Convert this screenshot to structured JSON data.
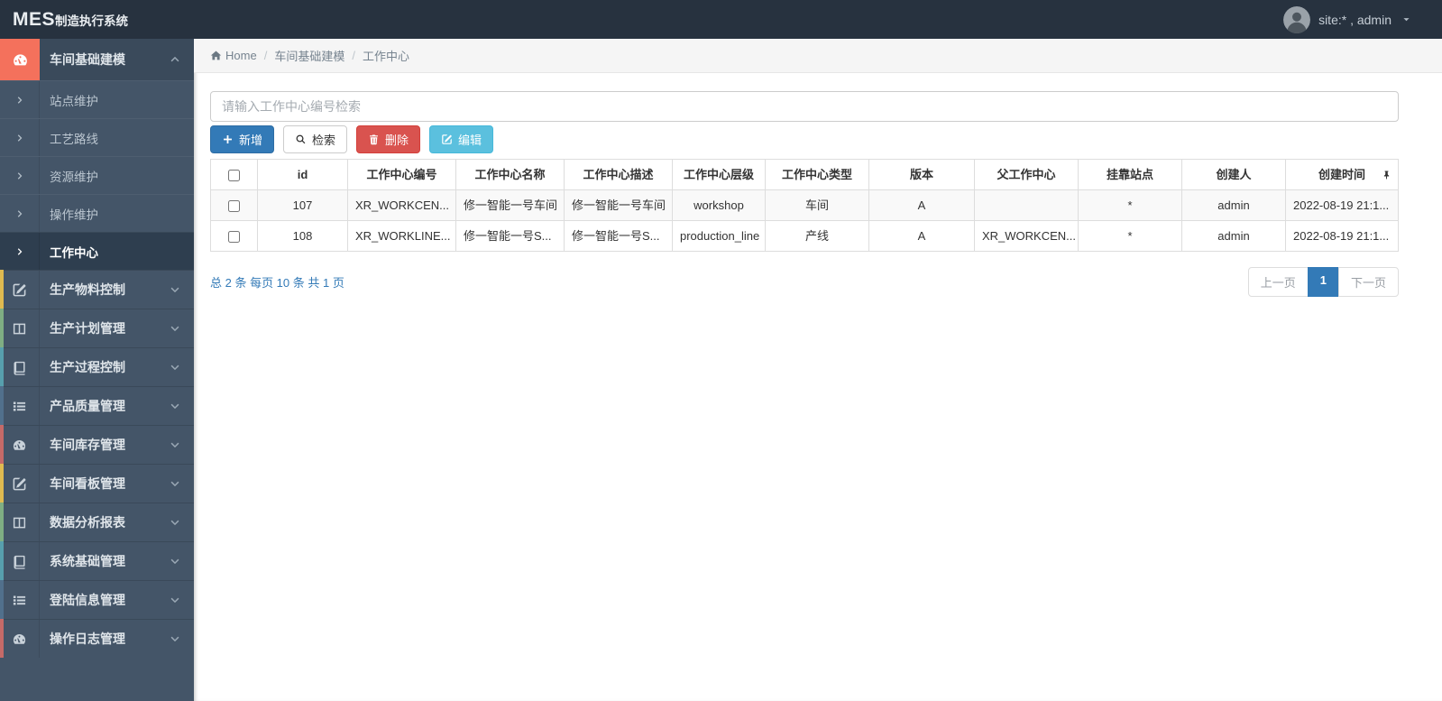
{
  "colors": {
    "navbar_bg": "#27323F",
    "sidebar_bg": "#445568",
    "sidebar_open_icon_bg": "#F4715C",
    "primary": "#337AB7",
    "danger": "#D9534F",
    "info": "#5BC0DE",
    "link_blue": "#337AB7"
  },
  "navbar": {
    "brand_mes": "MES",
    "brand_rest": "制造执行系统",
    "user_label": "site:* , admin"
  },
  "sidebar": {
    "active_parent": {
      "label": "车间基础建模",
      "icon": "gauge-icon",
      "accent": "#F4715C"
    },
    "submenu": {
      "active_index": 4,
      "items": [
        "站点维护",
        "工艺路线",
        "资源维护",
        "操作维护",
        "工作中心"
      ]
    },
    "items": [
      {
        "label": "生产物料控制",
        "icon": "pencil-square-icon",
        "accent": "#DFBA50"
      },
      {
        "label": "生产计划管理",
        "icon": "columns-icon",
        "accent": "#7FAE83"
      },
      {
        "label": "生产过程控制",
        "icon": "book-icon",
        "accent": "#579FAD"
      },
      {
        "label": "产品质量管理",
        "icon": "list-icon",
        "accent": "#51708C"
      },
      {
        "label": "车间库存管理",
        "icon": "gauge-icon",
        "accent": "#C56A68"
      },
      {
        "label": "车间看板管理",
        "icon": "pencil-square-icon",
        "accent": "#DFBA50"
      },
      {
        "label": "数据分析报表",
        "icon": "columns-icon",
        "accent": "#7FAE83"
      },
      {
        "label": "系统基础管理",
        "icon": "book-icon",
        "accent": "#579FAD"
      },
      {
        "label": "登陆信息管理",
        "icon": "list-icon",
        "accent": "#51708C"
      },
      {
        "label": "操作日志管理",
        "icon": "gauge-icon",
        "accent": "#C56A68"
      }
    ]
  },
  "breadcrumb": {
    "home_label": "Home",
    "separator": "/",
    "items": [
      "车间基础建模",
      "工作中心"
    ]
  },
  "toolbar": {
    "search_placeholder": "请输入工作中心编号检索",
    "search_value": "",
    "buttons": [
      {
        "name": "add-button",
        "label": "新增",
        "icon": "plus-icon",
        "style": "primary"
      },
      {
        "name": "search-button",
        "label": "检索",
        "icon": "search-icon",
        "style": "default"
      },
      {
        "name": "delete-button",
        "label": "删除",
        "icon": "trash-icon",
        "style": "danger"
      },
      {
        "name": "edit-button",
        "label": "编辑",
        "icon": "edit-icon",
        "style": "info"
      }
    ]
  },
  "table": {
    "headers": [
      {
        "checkbox": true
      },
      {
        "label": "id"
      },
      {
        "label": "工作中心编号"
      },
      {
        "label": "工作中心名称"
      },
      {
        "label": "工作中心描述"
      },
      {
        "label": "工作中心层级"
      },
      {
        "label": "工作中心类型"
      },
      {
        "label": "版本"
      },
      {
        "label": "父工作中心"
      },
      {
        "label": "挂靠站点"
      },
      {
        "label": "创建人"
      },
      {
        "label": "创建时间",
        "pin": true
      }
    ],
    "rows": [
      {
        "cells": [
          "107",
          "XR_WORKCEN...",
          "修一智能一号车间",
          "修一智能一号车间",
          "workshop",
          "车间",
          "A",
          "",
          "*",
          "admin",
          "2022-08-19 21:1..."
        ]
      },
      {
        "cells": [
          "108",
          "XR_WORKLINE...",
          "修一智能一号S...",
          "修一智能一号S...",
          "production_line",
          "产线",
          "A",
          "XR_WORKCEN...",
          "*",
          "admin",
          "2022-08-19 21:1..."
        ]
      }
    ]
  },
  "pagination": {
    "summary": "总 2 条 每页 10 条 共 1 页",
    "prev": "上一页",
    "page": "1",
    "next": "下一页"
  }
}
